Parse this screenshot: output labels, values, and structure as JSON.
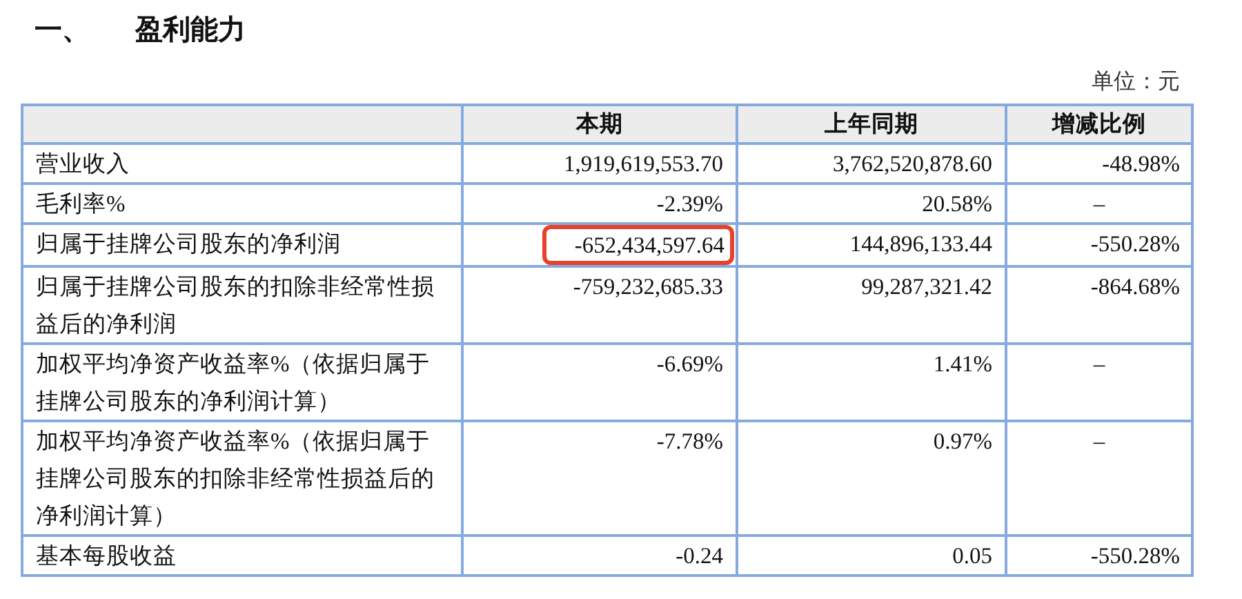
{
  "section": {
    "number": "一、",
    "title": "盈利能力"
  },
  "unit": "单位：元",
  "table": {
    "columns": [
      "",
      "本期",
      "上年同期",
      "增减比例"
    ],
    "rows": [
      {
        "cells": [
          "营业收入",
          "1,919,619,553.70",
          "3,762,520,878.60",
          "-48.98%"
        ],
        "highlighted": false
      },
      {
        "cells": [
          "毛利率%",
          "-2.39%",
          "20.58%",
          "–"
        ],
        "highlighted": false
      },
      {
        "cells": [
          "归属于挂牌公司股东的净利润",
          "-652,434,597.64",
          "144,896,133.44",
          "-550.28%"
        ],
        "highlighted": true
      },
      {
        "cells": [
          "归属于挂牌公司股东的扣除非经常性损益后的净利润",
          "-759,232,685.33",
          "99,287,321.42",
          "-864.68%"
        ],
        "highlighted": false
      },
      {
        "cells": [
          "加权平均净资产收益率%（依据归属于挂牌公司股东的净利润计算）",
          "-6.69%",
          "1.41%",
          "–"
        ],
        "highlighted": false
      },
      {
        "cells": [
          "加权平均净资产收益率%（依据归属于挂牌公司股东的扣除非经常性损益后的净利润计算）",
          "-7.78%",
          "0.97%",
          "–"
        ],
        "highlighted": false
      },
      {
        "cells": [
          "基本每股收益",
          "-0.24",
          "0.05",
          "-550.28%"
        ],
        "highlighted": false
      }
    ]
  }
}
